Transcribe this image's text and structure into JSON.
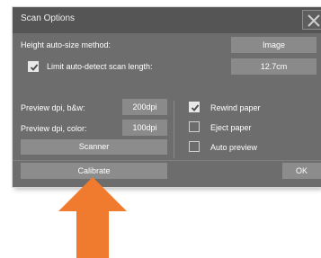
{
  "dialog": {
    "title": "Scan Options"
  },
  "height_method": {
    "label": "Height auto-size method:",
    "value": "Image"
  },
  "limit_scan": {
    "label": "Limit auto-detect scan length:",
    "checked": true,
    "value": "12.7cm"
  },
  "preview_bw": {
    "label": "Preview dpi, b&w:",
    "value": "200dpi"
  },
  "preview_color": {
    "label": "Preview dpi, color:",
    "value": "100dpi"
  },
  "buttons": {
    "scanner": "Scanner",
    "calibrate": "Calibrate",
    "ok": "OK"
  },
  "options": [
    {
      "label": "Rewind paper",
      "checked": true
    },
    {
      "label": "Eject paper",
      "checked": false
    },
    {
      "label": "Auto preview",
      "checked": false
    }
  ],
  "colors": {
    "dialog_bg": "#6d6d6d",
    "titlebar_bg": "#555555",
    "button_bg": "#8c8c8c",
    "arrow": "#f07a2e"
  }
}
